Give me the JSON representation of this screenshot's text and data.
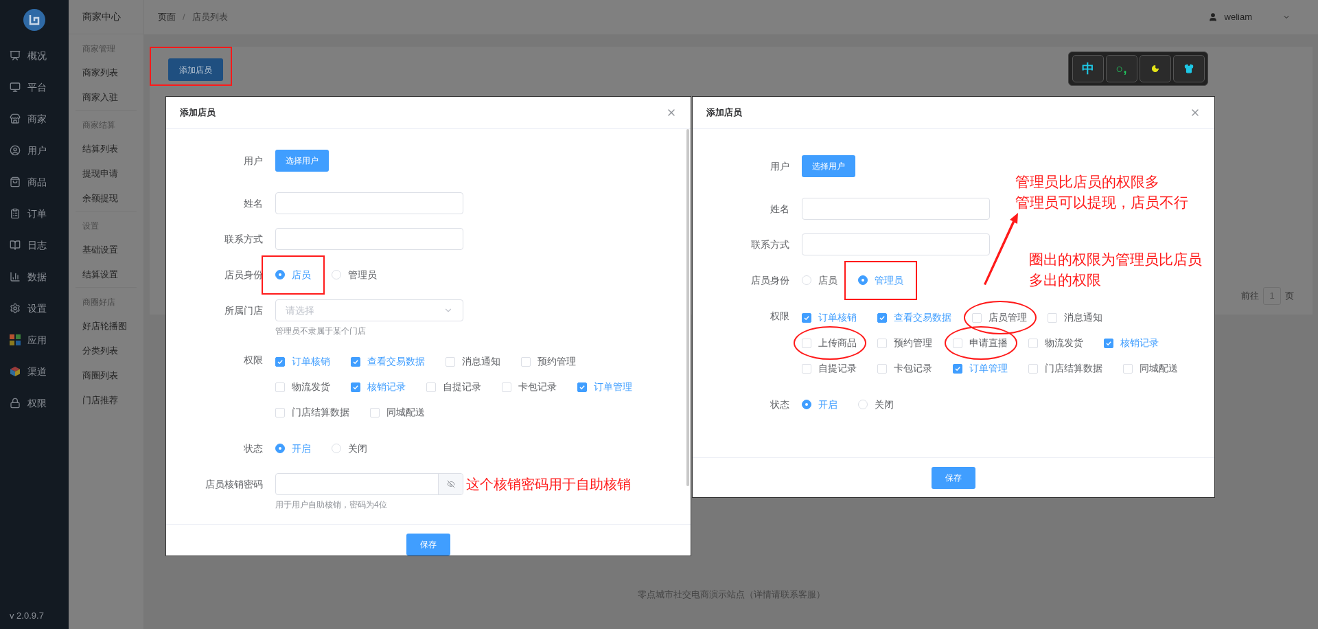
{
  "sidebar": {
    "items": [
      {
        "label": "概况"
      },
      {
        "label": "平台"
      },
      {
        "label": "商家"
      },
      {
        "label": "用户"
      },
      {
        "label": "商品"
      },
      {
        "label": "订单"
      },
      {
        "label": "日志"
      },
      {
        "label": "数据"
      },
      {
        "label": "设置"
      },
      {
        "label": "应用"
      },
      {
        "label": "渠道"
      },
      {
        "label": "权限"
      }
    ],
    "version": "v 2.0.9.7"
  },
  "submenu": {
    "title": "商家中心",
    "groups": [
      {
        "heading": "商家管理",
        "items": [
          "商家列表",
          "商家入驻"
        ]
      },
      {
        "heading": "商家结算",
        "items": [
          "结算列表",
          "提现申请",
          "余额提现"
        ]
      },
      {
        "heading": "设置",
        "items": [
          "基础设置",
          "结算设置"
        ]
      },
      {
        "heading": "商圈好店",
        "items": [
          "好店轮播图",
          "分类列表",
          "商圈列表",
          "门店推荐"
        ]
      }
    ]
  },
  "topbar": {
    "breadcrumb": [
      "页面",
      "店员列表"
    ],
    "separator": "/",
    "user": "weliam"
  },
  "page": {
    "add_button": {
      "label": "添加店员",
      "highlighted": true
    },
    "pagination": {
      "prefix": "前往",
      "page": "1",
      "suffix": "页"
    },
    "footer": "零点城市社交电商演示站点（详情请联系客服）"
  },
  "ime_toolbar": {
    "keys": [
      {
        "kind": "text",
        "label": "中",
        "color": "#1ec8e6"
      },
      {
        "kind": "text",
        "label": "○,",
        "color": "#22c55e"
      },
      {
        "kind": "moon",
        "color": "#e5e517"
      },
      {
        "kind": "shirt",
        "color": "#1ec8e6"
      }
    ]
  },
  "dialogs": [
    {
      "title": "添加店员",
      "fields": [
        {
          "kind": "button",
          "label": "用户",
          "button": "选择用户"
        },
        {
          "kind": "input",
          "label": "姓名"
        },
        {
          "kind": "input",
          "label": "联系方式"
        },
        {
          "kind": "radio",
          "label": "店员身份",
          "options": [
            {
              "label": "店员",
              "selected": true,
              "highlighted": true
            },
            {
              "label": "管理员",
              "selected": false,
              "highlighted": false
            }
          ]
        },
        {
          "kind": "select",
          "label": "所属门店",
          "placeholder": "请选择",
          "hint": "管理员不隶属于某个门店"
        },
        {
          "kind": "checkboxes",
          "label": "权限",
          "rows": [
            [
              {
                "label": "订单核销",
                "checked": true,
                "circled": false
              },
              {
                "label": "查看交易数据",
                "checked": true,
                "circled": false
              },
              {
                "label": "消息通知",
                "checked": false,
                "circled": false
              },
              {
                "label": "预约管理",
                "checked": false,
                "circled": false
              }
            ],
            [
              {
                "label": "物流发货",
                "checked": false,
                "circled": false
              },
              {
                "label": "核销记录",
                "checked": true,
                "circled": false
              },
              {
                "label": "自提记录",
                "checked": false,
                "circled": false
              },
              {
                "label": "卡包记录",
                "checked": false,
                "circled": false
              },
              {
                "label": "订单管理",
                "checked": true,
                "circled": false
              }
            ],
            [
              {
                "label": "门店结算数据",
                "checked": false,
                "circled": false
              },
              {
                "label": "同城配送",
                "checked": false,
                "circled": false
              }
            ]
          ]
        },
        {
          "kind": "radio",
          "label": "状态",
          "options": [
            {
              "label": "开启",
              "selected": true,
              "highlighted": false
            },
            {
              "label": "关闭",
              "selected": false,
              "highlighted": false
            }
          ]
        },
        {
          "kind": "password",
          "label": "店员核销密码",
          "hint": "用于用户自助核销，密码为4位",
          "note": "这个核销密码用于自助核销"
        }
      ],
      "save": "保存"
    },
    {
      "title": "添加店员",
      "fields": [
        {
          "kind": "button",
          "label": "用户",
          "button": "选择用户"
        },
        {
          "kind": "input",
          "label": "姓名"
        },
        {
          "kind": "input",
          "label": "联系方式"
        },
        {
          "kind": "radio",
          "label": "店员身份",
          "options": [
            {
              "label": "店员",
              "selected": false,
              "highlighted": false
            },
            {
              "label": "管理员",
              "selected": true,
              "highlighted": true
            }
          ]
        },
        {
          "kind": "checkboxes",
          "label": "权限",
          "rows": [
            [
              {
                "label": "订单核销",
                "checked": true,
                "circled": false
              },
              {
                "label": "查看交易数据",
                "checked": true,
                "circled": false
              },
              {
                "label": "店员管理",
                "checked": false,
                "circled": true
              },
              {
                "label": "消息通知",
                "checked": false,
                "circled": false
              }
            ],
            [
              {
                "label": "上传商品",
                "checked": false,
                "circled": true
              },
              {
                "label": "预约管理",
                "checked": false,
                "circled": false
              },
              {
                "label": "申请直播",
                "checked": false,
                "circled": true
              },
              {
                "label": "物流发货",
                "checked": false,
                "circled": false
              },
              {
                "label": "核销记录",
                "checked": true,
                "circled": false
              }
            ],
            [
              {
                "label": "自提记录",
                "checked": false,
                "circled": false
              },
              {
                "label": "卡包记录",
                "checked": false,
                "circled": false
              },
              {
                "label": "订单管理",
                "checked": true,
                "circled": false
              },
              {
                "label": "门店结算数据",
                "checked": false,
                "circled": false
              },
              {
                "label": "同城配送",
                "checked": false,
                "circled": false
              }
            ]
          ]
        },
        {
          "kind": "radio",
          "label": "状态",
          "options": [
            {
              "label": "开启",
              "selected": true,
              "highlighted": false
            },
            {
              "label": "关闭",
              "selected": false,
              "highlighted": false
            }
          ]
        }
      ],
      "save": "保存",
      "notes": [
        {
          "kind": "text",
          "lines": [
            "管理员比店员的权限多",
            "管理员可以提现，店员不行"
          ]
        },
        {
          "kind": "arrow"
        },
        {
          "kind": "text",
          "lines": [
            "圈出的权限为管理员比店员",
            "多出的权限"
          ]
        }
      ]
    }
  ]
}
